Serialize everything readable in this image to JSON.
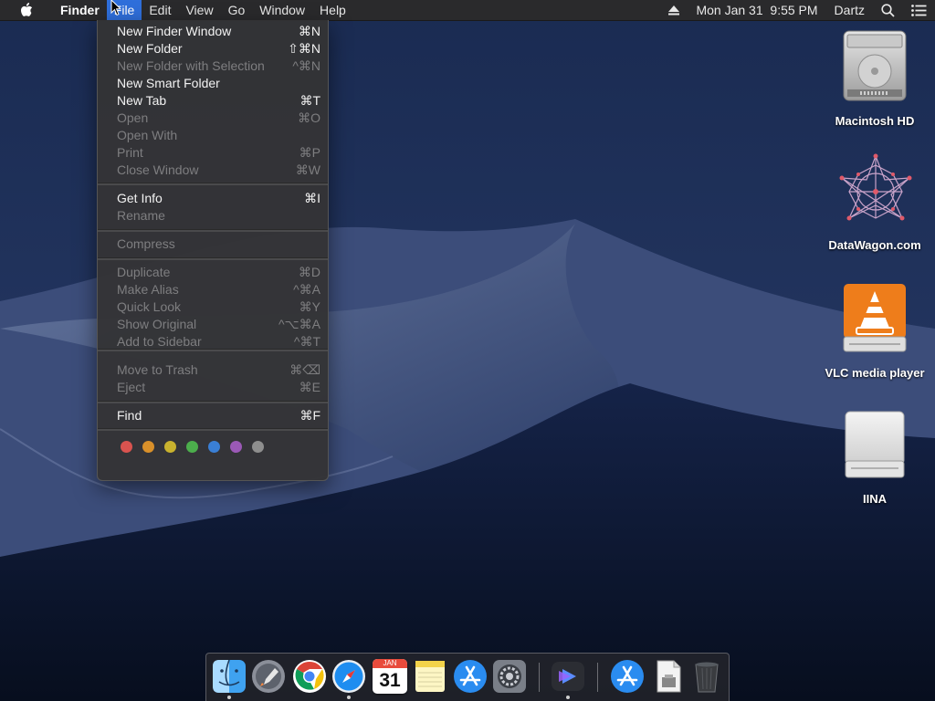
{
  "menubar": {
    "app_name": "Finder",
    "menus": [
      "File",
      "Edit",
      "View",
      "Go",
      "Window",
      "Help"
    ],
    "active_menu": "File",
    "clock": "Mon Jan 31  9:55 PM",
    "user": "Dartz",
    "status_icons": [
      "eject-icon",
      "search-icon",
      "notification-center-icon"
    ]
  },
  "file_menu": {
    "items": [
      {
        "label": "New Finder Window",
        "shortcut": "⌘N",
        "enabled": true
      },
      {
        "label": "New Folder",
        "shortcut": "⇧⌘N",
        "enabled": true
      },
      {
        "label": "New Folder with Selection",
        "shortcut": "^⌘N",
        "enabled": false
      },
      {
        "label": "New Smart Folder",
        "shortcut": "",
        "enabled": true
      },
      {
        "label": "New Tab",
        "shortcut": "⌘T",
        "enabled": true
      },
      {
        "label": "Open",
        "shortcut": "⌘O",
        "enabled": false
      },
      {
        "label": "Open With",
        "shortcut": "",
        "enabled": false
      },
      {
        "label": "Print",
        "shortcut": "⌘P",
        "enabled": false
      },
      {
        "label": "Close Window",
        "shortcut": "⌘W",
        "enabled": false
      },
      {
        "label": "Get Info",
        "shortcut": "⌘I",
        "enabled": true
      },
      {
        "label": "Rename",
        "shortcut": "",
        "enabled": false
      },
      {
        "label": "Compress",
        "shortcut": "",
        "enabled": false
      },
      {
        "label": "Duplicate",
        "shortcut": "⌘D",
        "enabled": false
      },
      {
        "label": "Make Alias",
        "shortcut": "^⌘A",
        "enabled": false
      },
      {
        "label": "Quick Look",
        "shortcut": "⌘Y",
        "enabled": false
      },
      {
        "label": "Show Original",
        "shortcut": "^⌥⌘A",
        "enabled": false
      },
      {
        "label": "Add to Sidebar",
        "shortcut": "^⌘T",
        "enabled": false
      },
      {
        "label": "Move to Trash",
        "shortcut": "⌘⌫",
        "enabled": false
      },
      {
        "label": "Eject",
        "shortcut": "⌘E",
        "enabled": false
      },
      {
        "label": "Find",
        "shortcut": "⌘F",
        "enabled": true
      }
    ],
    "tag_colors": [
      "#d9534f",
      "#d9902a",
      "#c9b22e",
      "#4cae4c",
      "#3a7fd5",
      "#9b59b6",
      "#8e8e8e"
    ]
  },
  "desktop_icons": [
    {
      "label": "Macintosh HD",
      "icon": "hard-drive-icon"
    },
    {
      "label": "DataWagon.com",
      "icon": "network-star-icon"
    },
    {
      "label": "VLC media player",
      "icon": "vlc-disk-icon"
    },
    {
      "label": "IINA",
      "icon": "external-drive-icon"
    }
  ],
  "dock": {
    "apps": [
      {
        "name": "Finder",
        "icon": "finder-icon",
        "running": true
      },
      {
        "name": "Launchpad",
        "icon": "launchpad-icon",
        "running": false
      },
      {
        "name": "Google Chrome",
        "icon": "chrome-icon",
        "running": false
      },
      {
        "name": "Safari",
        "icon": "safari-icon",
        "running": true
      },
      {
        "name": "Calendar",
        "icon": "calendar-icon",
        "running": false,
        "month": "JAN",
        "day": "31"
      },
      {
        "name": "Notes",
        "icon": "notes-icon",
        "running": false
      },
      {
        "name": "App Store",
        "icon": "app-store-icon",
        "running": false
      },
      {
        "name": "System Preferences",
        "icon": "system-preferences-icon",
        "running": false
      },
      {
        "name": "IINA",
        "icon": "iina-icon",
        "running": true
      },
      {
        "name": "Applications",
        "icon": "applications-folder-icon",
        "running": false
      },
      {
        "name": "Downloads",
        "icon": "document-stack-icon",
        "running": false
      },
      {
        "name": "Trash",
        "icon": "trash-icon",
        "running": false
      }
    ]
  },
  "colors": {
    "menu_highlight": "#2f6fdb",
    "menubar_bg": "#2a2a2c",
    "menu_bg": "#343436"
  }
}
